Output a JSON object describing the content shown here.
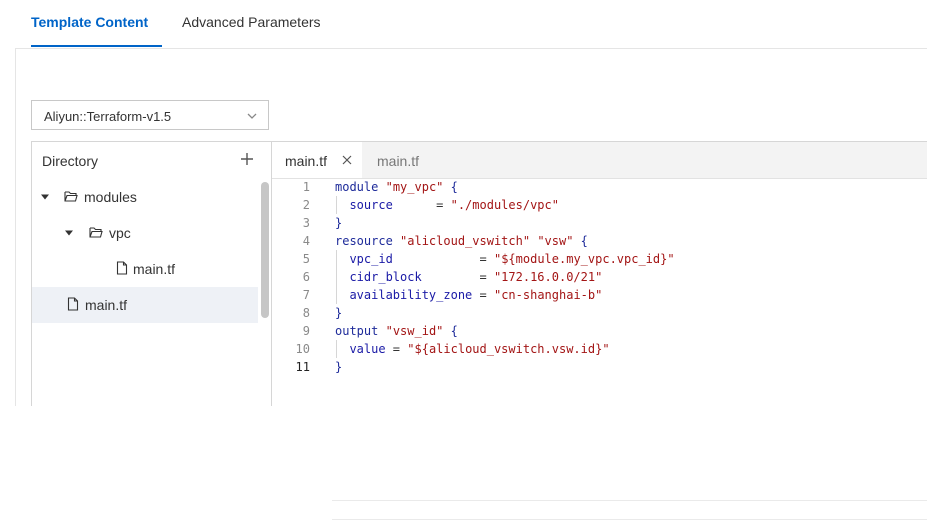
{
  "tabs": {
    "template_content": "Template Content",
    "advanced_parameters": "Advanced Parameters"
  },
  "version_select": {
    "value": "Aliyun::Terraform-v1.5"
  },
  "directory": {
    "title": "Directory",
    "items": [
      {
        "label": "modules",
        "type": "folder",
        "expanded": true
      },
      {
        "label": "vpc",
        "type": "folder",
        "expanded": true
      },
      {
        "label": "main.tf",
        "type": "file"
      },
      {
        "label": "main.tf",
        "type": "file",
        "selected": true
      }
    ]
  },
  "editor": {
    "tabs": [
      {
        "label": "main.tf",
        "active": true
      },
      {
        "label": "main.tf",
        "active": false
      }
    ],
    "current_line": 11,
    "lines": [
      {
        "n": "1",
        "tokens": [
          [
            "kw",
            "module"
          ],
          [
            "plain",
            " "
          ],
          [
            "str",
            "\"my_vpc\""
          ],
          [
            "plain",
            " "
          ],
          [
            "brace",
            "{"
          ]
        ]
      },
      {
        "n": "2",
        "tokens": [
          [
            "plain",
            "  "
          ],
          [
            "attr",
            "source"
          ],
          [
            "plain",
            "      = "
          ],
          [
            "str",
            "\"./modules/vpc\""
          ]
        ]
      },
      {
        "n": "3",
        "tokens": [
          [
            "brace",
            "}"
          ]
        ]
      },
      {
        "n": "4",
        "tokens": [
          [
            "kw",
            "resource"
          ],
          [
            "plain",
            " "
          ],
          [
            "str",
            "\"alicloud_vswitch\""
          ],
          [
            "plain",
            " "
          ],
          [
            "str",
            "\"vsw\""
          ],
          [
            "plain",
            " "
          ],
          [
            "brace",
            "{"
          ]
        ]
      },
      {
        "n": "5",
        "tokens": [
          [
            "plain",
            "  "
          ],
          [
            "attr",
            "vpc_id"
          ],
          [
            "plain",
            "            = "
          ],
          [
            "str",
            "\"${module.my_vpc.vpc_id}\""
          ]
        ]
      },
      {
        "n": "6",
        "tokens": [
          [
            "plain",
            "  "
          ],
          [
            "attr",
            "cidr_block"
          ],
          [
            "plain",
            "        = "
          ],
          [
            "str",
            "\"172.16.0.0/21\""
          ]
        ]
      },
      {
        "n": "7",
        "tokens": [
          [
            "plain",
            "  "
          ],
          [
            "attr",
            "availability_zone"
          ],
          [
            "plain",
            " = "
          ],
          [
            "str",
            "\"cn-shanghai-b\""
          ]
        ]
      },
      {
        "n": "8",
        "tokens": [
          [
            "brace",
            "}"
          ]
        ]
      },
      {
        "n": "9",
        "tokens": [
          [
            "kw",
            "output"
          ],
          [
            "plain",
            " "
          ],
          [
            "str",
            "\"vsw_id\""
          ],
          [
            "plain",
            " "
          ],
          [
            "brace",
            "{"
          ]
        ]
      },
      {
        "n": "10",
        "tokens": [
          [
            "plain",
            "  "
          ],
          [
            "attr",
            "value"
          ],
          [
            "plain",
            " = "
          ],
          [
            "str",
            "\"${alicloud_vswitch.vsw.id}\""
          ]
        ]
      },
      {
        "n": "11",
        "tokens": [
          [
            "brace",
            "}"
          ]
        ]
      }
    ]
  }
}
